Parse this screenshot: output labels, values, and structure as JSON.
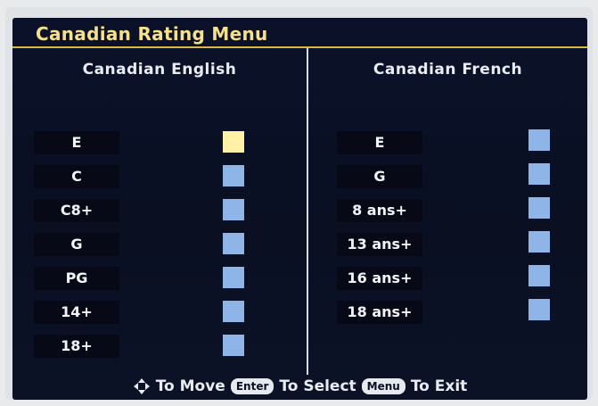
{
  "menu": {
    "title": "Canadian Rating Menu"
  },
  "english": {
    "heading": "Canadian English",
    "ratings": [
      {
        "label": "E",
        "selected": true
      },
      {
        "label": "C",
        "selected": false
      },
      {
        "label": "C8+",
        "selected": false
      },
      {
        "label": "G",
        "selected": false
      },
      {
        "label": "PG",
        "selected": false
      },
      {
        "label": "14+",
        "selected": false
      },
      {
        "label": "18+",
        "selected": false
      }
    ]
  },
  "french": {
    "heading": "Canadian French",
    "ratings": [
      {
        "label": "E",
        "selected": false
      },
      {
        "label": "G",
        "selected": false
      },
      {
        "label": "8 ans+",
        "selected": false
      },
      {
        "label": "13 ans+",
        "selected": false
      },
      {
        "label": "16 ans+",
        "selected": false
      },
      {
        "label": "18 ans+",
        "selected": false
      }
    ]
  },
  "footer": {
    "move_text": "To Move",
    "enter_key": "Enter",
    "select_text": "To Select",
    "menu_key": "Menu",
    "exit_text": "To Exit",
    "move_icon": "four-way-arrow-icon"
  },
  "colors": {
    "background": "#0a1024",
    "title": "#f5e08c",
    "title_rule": "#d8b84a",
    "checkbox_unchecked": "#8fb4e8",
    "checkbox_selected": "#fff1a6"
  }
}
